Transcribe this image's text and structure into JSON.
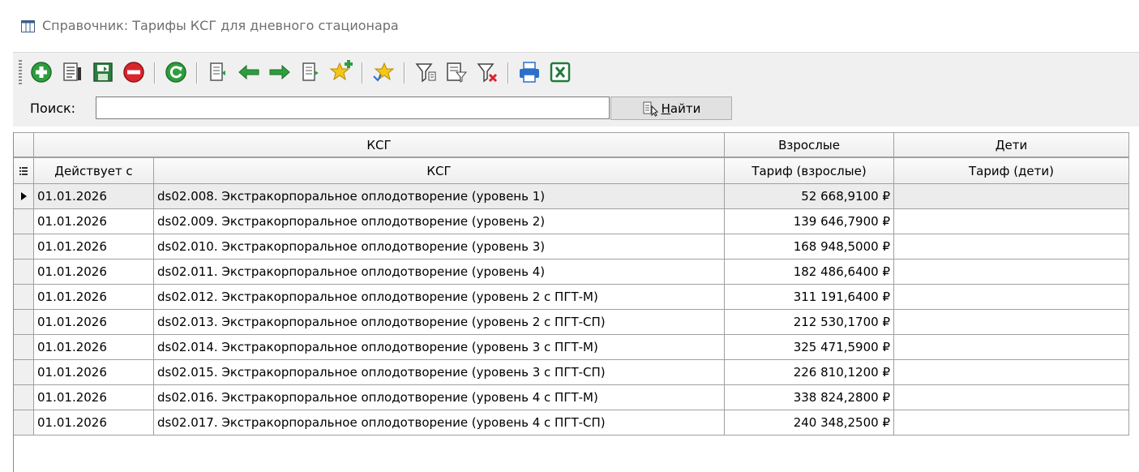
{
  "window": {
    "title": "Справочник: Тарифы КСГ для дневного стационара"
  },
  "toolbar": {
    "buttons": [
      {
        "icon": "add-icon"
      },
      {
        "icon": "edit-icon"
      },
      {
        "icon": "save-icon"
      },
      {
        "icon": "delete-icon"
      },
      {
        "icon": "refresh-icon"
      },
      {
        "icon": "first-record-icon"
      },
      {
        "icon": "previous-record-icon"
      },
      {
        "icon": "next-record-icon"
      },
      {
        "icon": "last-record-icon"
      },
      {
        "icon": "add-favorite-icon"
      },
      {
        "icon": "favorites-icon"
      },
      {
        "icon": "filter-icon"
      },
      {
        "icon": "filter-edit-icon"
      },
      {
        "icon": "clear-filter-icon"
      },
      {
        "icon": "print-icon"
      },
      {
        "icon": "excel-export-icon"
      }
    ]
  },
  "search": {
    "label": "Поиск:",
    "value": "",
    "button_hotkey": "Н",
    "button_rest": "айти"
  },
  "grid": {
    "bands": [
      "КСГ",
      "Взрослые",
      "Дети"
    ],
    "columns": [
      "Действует с",
      "КСГ",
      "Тариф (взрослые)",
      "Тариф (дети)"
    ],
    "rows": [
      {
        "date": "01.01.2026",
        "ksg": "ds02.008. Экстракорпоральное оплодотворение (уровень 1)",
        "adult": "52 668,9100 ₽",
        "kids": ""
      },
      {
        "date": "01.01.2026",
        "ksg": "ds02.009. Экстракорпоральное оплодотворение (уровень 2)",
        "adult": "139 646,7900 ₽",
        "kids": ""
      },
      {
        "date": "01.01.2026",
        "ksg": "ds02.010. Экстракорпоральное оплодотворение (уровень 3)",
        "adult": "168 948,5000 ₽",
        "kids": ""
      },
      {
        "date": "01.01.2026",
        "ksg": "ds02.011. Экстракорпоральное оплодотворение (уровень 4)",
        "adult": "182 486,6400 ₽",
        "kids": ""
      },
      {
        "date": "01.01.2026",
        "ksg": "ds02.012. Экстракорпоральное оплодотворение (уровень 2 с ПГТ-М)",
        "adult": "311 191,6400 ₽",
        "kids": ""
      },
      {
        "date": "01.01.2026",
        "ksg": "ds02.013. Экстракорпоральное оплодотворение (уровень 2 с ПГТ-СП)",
        "adult": "212 530,1700 ₽",
        "kids": ""
      },
      {
        "date": "01.01.2026",
        "ksg": "ds02.014. Экстракорпоральное оплодотворение (уровень 3 с ПГТ-М)",
        "adult": "325 471,5900 ₽",
        "kids": ""
      },
      {
        "date": "01.01.2026",
        "ksg": "ds02.015. Экстракорпоральное оплодотворение (уровень 3 с ПГТ-СП)",
        "adult": "226 810,1200 ₽",
        "kids": ""
      },
      {
        "date": "01.01.2026",
        "ksg": "ds02.016. Экстракорпоральное оплодотворение (уровень 4 с ПГТ-М)",
        "adult": "338 824,2800 ₽",
        "kids": ""
      },
      {
        "date": "01.01.2026",
        "ksg": "ds02.017. Экстракорпоральное оплодотворение (уровень 4 с ПГТ-СП)",
        "adult": "240 348,2500 ₽",
        "kids": ""
      }
    ],
    "current_row": 0
  }
}
